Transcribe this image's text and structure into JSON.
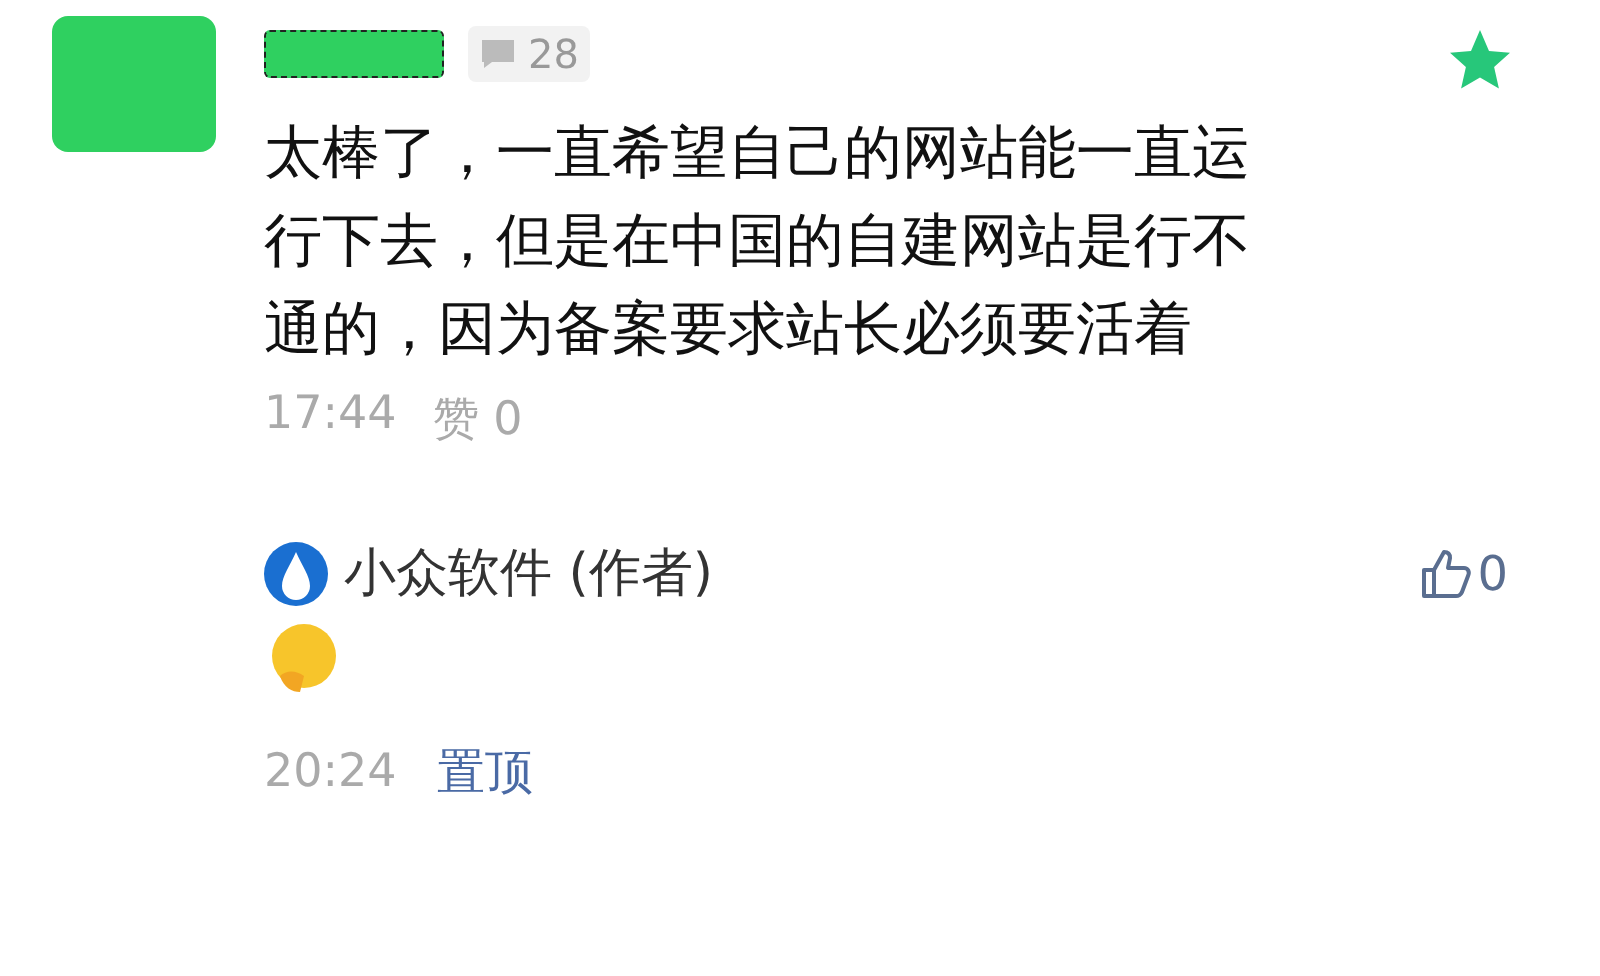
{
  "comment": {
    "starred": true,
    "reply_count": "28",
    "text": "太棒了，一直希望自己的网站能一直运行下去，但是在中国的自建网站是行不通的，因为备案要求站长必须要活着",
    "time": "17:44",
    "likes": "赞 0"
  },
  "reply": {
    "author": "小众软件 (作者)",
    "likes": "0",
    "time": "20:24",
    "pin_label": "置顶"
  }
}
